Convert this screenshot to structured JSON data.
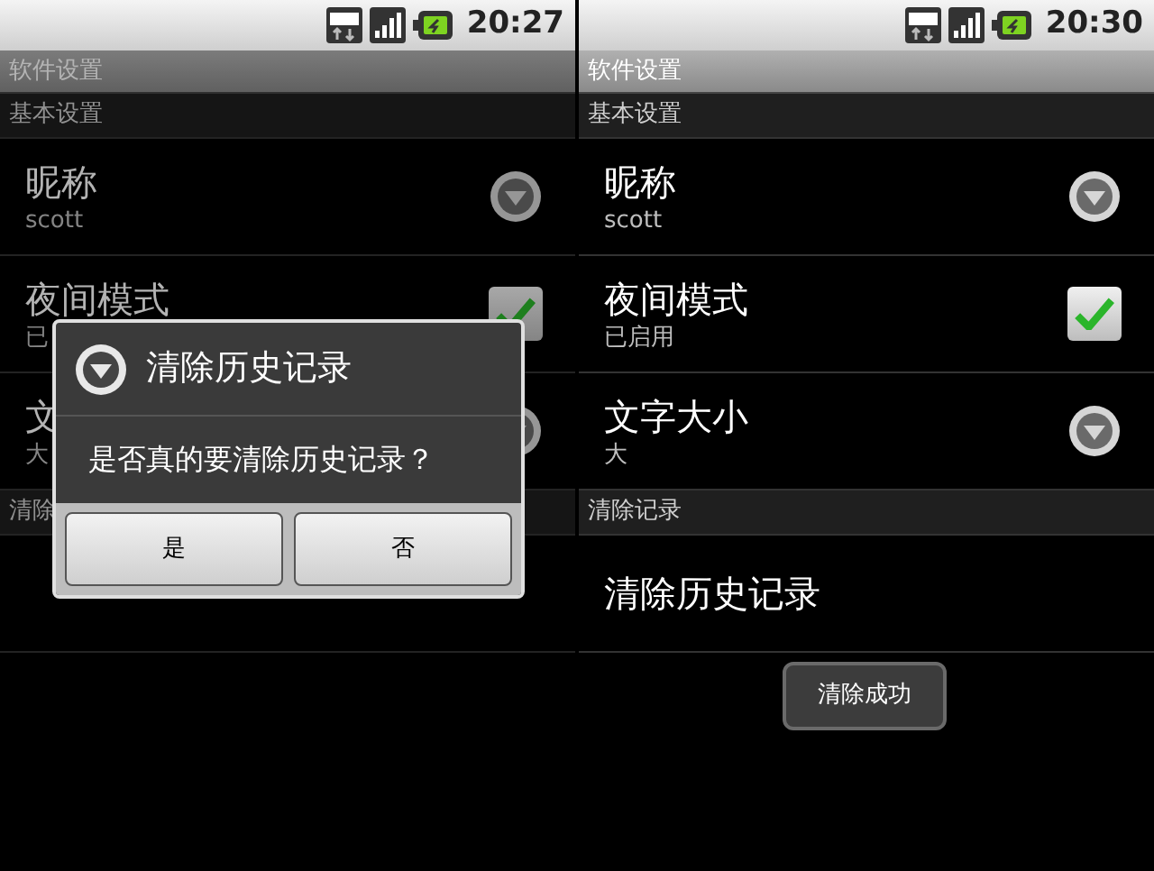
{
  "screens": [
    {
      "status_bar": {
        "time": "20:27"
      },
      "title": "软件设置",
      "dimmed": true,
      "sections": [
        {
          "header": "基本设置",
          "items": [
            {
              "kind": "dropdown",
              "title": "昵称",
              "summary": "scott"
            },
            {
              "kind": "checkbox",
              "title": "夜间模式",
              "summary": "已",
              "checked": true
            },
            {
              "kind": "dropdown",
              "title": "文",
              "summary": "大"
            }
          ]
        },
        {
          "header": "清除",
          "items": [
            {
              "kind": "action"
            }
          ]
        }
      ],
      "dialog": {
        "title": "清除历史记录",
        "message": "是否真的要清除历史记录？",
        "buttons": [
          "是",
          "否"
        ]
      }
    },
    {
      "status_bar": {
        "time": "20:30"
      },
      "title": "软件设置",
      "dimmed": false,
      "sections": [
        {
          "header": "基本设置",
          "items": [
            {
              "kind": "dropdown",
              "title": "昵称",
              "summary": "scott"
            },
            {
              "kind": "checkbox",
              "title": "夜间模式",
              "summary": "已启用",
              "checked": true
            },
            {
              "kind": "dropdown",
              "title": "文字大小",
              "summary": "大"
            }
          ]
        },
        {
          "header": "清除记录",
          "items": [
            {
              "kind": "action",
              "title": "清除历史记录"
            }
          ]
        }
      ],
      "toast": "清除成功"
    }
  ]
}
